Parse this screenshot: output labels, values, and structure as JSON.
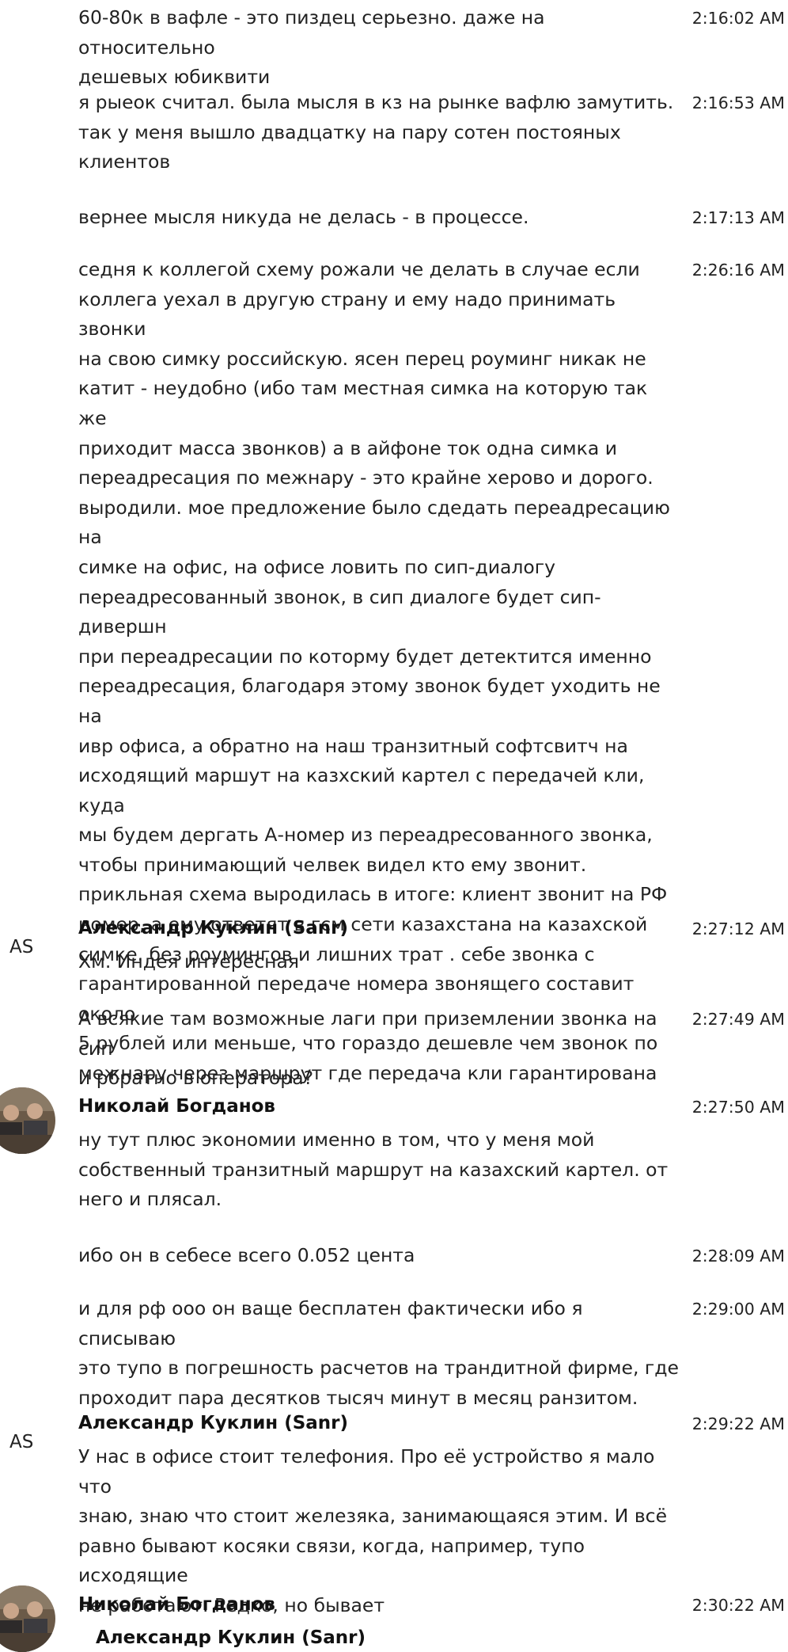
{
  "messages": [
    {
      "text": "60-80к в вафле - это пиздец серьезно. даже на относительно\nдешевых юбиквити",
      "time": "2:16:02 AM"
    },
    {
      "text": "я рыеок считал. была мысля в кз на рынке вафлю замутить.\nтак у меня вышло двадцатку на пару сотен постояных\nклиентов",
      "time": "2:16:53 AM"
    },
    {
      "text": "вернее мысля никуда не делась - в процессе.",
      "time": "2:17:13 AM"
    },
    {
      "text": "седня к коллегой схему рожали че делать в случае если\nколлега уехал в другую страну и ему надо принимать звонки\nна свою симку российскую. ясен перец роуминг никак не\nкатит - неудобно (ибо там местная симка на которую так же\nприходит масса звонков) а в айфоне ток одна симка и\nпереадресация по межнару - это крайне херово и дорого.\nвыродили. мое предложение было сдедать переадресацию на\nсимке на офис, на офисе ловить по сип-диалогу\nпереадресованный звонок, в сип диалоге будет сип-дивершн\nпри переадресации по которму будет детектится именно\nпереадресация, благодаря этому звонок будет уходить не на\nивр офиса, а обратно на наш транзитный софтсвитч на\nисходящий маршут на казхский картел с передачей кли, куда\nмы будем дергать А-номер из переадресованного звонка,\nчтобы принимающий челвек видел кто ему звонит.\nприкльная схема выродилась в итоге: клиент звонит на РФ\nномер, а ему ответят в гсм сети казахстана на казахской\nсимке. без роумингов и лишних трат . себе звонка с\nгарантированной передаче номера звонящего составит около\n5 рублей или меньше, что гораздо дешевле чем звонок по\nмежнару через маршрут где передача кли гарантирована",
      "time": "2:26:16 AM"
    },
    {
      "author": "Александр Куклин (Sanr)",
      "avatar_initials": "AS",
      "time": "2:27:12 AM",
      "text": "Хм. Индея интересная"
    },
    {
      "text": "А всякие там возможные лаги при приземлении звонка на сип\nи рбратно в оператора?",
      "time": "2:27:49 AM"
    },
    {
      "author": "Николай Богданов",
      "avatar_icon": "user-photo",
      "time": "2:27:50 AM",
      "text": "ну тут плюс экономии именно в том, что у меня мой\nсобственный транзитный маршрут на казахский картел. от\nнего и плясал."
    },
    {
      "text": "ибо он в себесе всего 0.052 цента",
      "time": "2:28:09 AM"
    },
    {
      "text": "и для рф ооо он ваще бесплатен фактически ибо я списываю\nэто тупо в погрешность расчетов на трандитной фирме, где\nпроходит пара десятков тысяч минут в месяц ранзитом.",
      "time": "2:29:00 AM"
    },
    {
      "author": "Александр Куклин (Sanr)",
      "avatar_initials": "AS",
      "time": "2:29:22 AM",
      "text": "У нас в офисе стоит телефония. Про её устройство я мало что\nзнаю, знаю что стоит железяка, занимающаяся этим. И всё\nравно бывают косяки связи, когда, например, тупо исходящие\nне работают. Редко, но бывает"
    },
    {
      "author": "Николай Богданов",
      "avatar_icon": "user-photo",
      "time": "2:30:22 AM",
      "quote_author": "Александр Куклин (Sanr)"
    }
  ]
}
